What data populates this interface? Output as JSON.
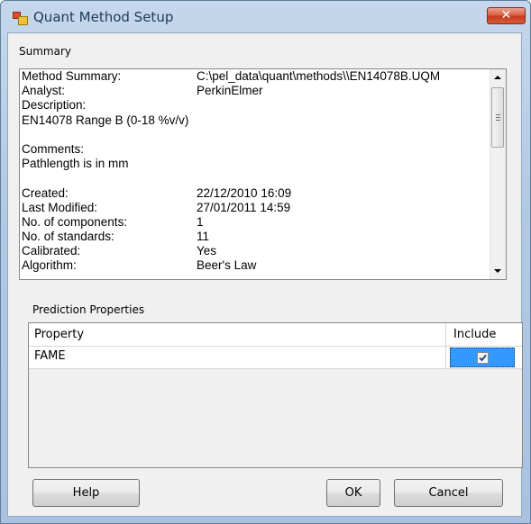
{
  "window": {
    "title": "Quant Method Setup",
    "close_label": "✕"
  },
  "summary": {
    "group_label": "Summary",
    "lines": [
      {
        "key": "Method Summary:",
        "value": "C:\\pel_data\\quant\\methods\\\\EN14078B.UQM"
      },
      {
        "key": "Analyst:",
        "value": "PerkinElmer"
      },
      {
        "key": "Description:",
        "value": ""
      },
      {
        "key": "EN14078 Range B (0-18 %v/v)",
        "value": ""
      },
      {
        "key": "",
        "value": ""
      },
      {
        "key": "Comments:",
        "value": ""
      },
      {
        "key": "Pathlength is in mm",
        "value": ""
      },
      {
        "key": "",
        "value": ""
      },
      {
        "key": "Created:",
        "value": "22/12/2010 16:09"
      },
      {
        "key": "Last Modified:",
        "value": "27/01/2011 14:59"
      },
      {
        "key": "No. of components:",
        "value": "1"
      },
      {
        "key": "No. of standards:",
        "value": "11"
      },
      {
        "key": "Calibrated:",
        "value": "Yes"
      },
      {
        "key": "Algorithm:",
        "value": "Beer's Law"
      }
    ]
  },
  "prediction": {
    "group_label": "Prediction Properties",
    "columns": [
      "Property",
      "Include"
    ],
    "rows": [
      {
        "property": "FAME",
        "include": true
      }
    ]
  },
  "buttons": {
    "help": "Help",
    "ok": "OK",
    "cancel": "Cancel"
  }
}
